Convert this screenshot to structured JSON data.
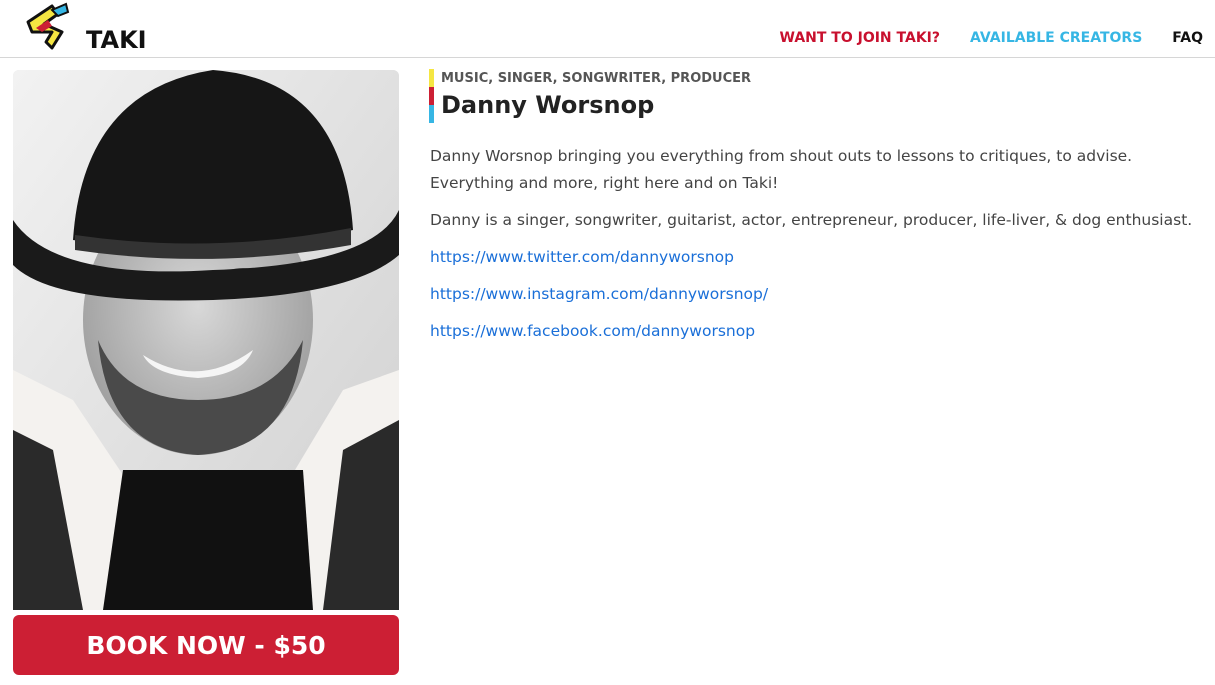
{
  "header": {
    "logo_text": "TAKI",
    "nav": {
      "join": "WANT TO JOIN TAKI?",
      "creators": "AVAILABLE CREATORS",
      "faq": "FAQ"
    }
  },
  "colors": {
    "brand_red": "#cc1f34",
    "brand_blue": "#36b6e4",
    "brand_yellow": "#f5e642",
    "link": "#1a6fd8"
  },
  "profile": {
    "categories": "MUSIC, SINGER, SONGWRITER, PRODUCER",
    "name": "Danny Worsnop",
    "bio_1": "Danny Worsnop bringing you everything from shout outs to lessons to critiques, to advise. Everything and more, right here and on Taki!",
    "bio_2": "Danny is a singer, songwriter, guitarist, actor, entrepreneur, producer, life-liver, & dog enthusiast.",
    "links": [
      "https://www.twitter.com/dannyworsnop",
      "https://www.instagram.com/dannyworsnop/",
      "https://www.facebook.com/dannyworsnop"
    ],
    "book_label": "BOOK NOW - $50"
  }
}
